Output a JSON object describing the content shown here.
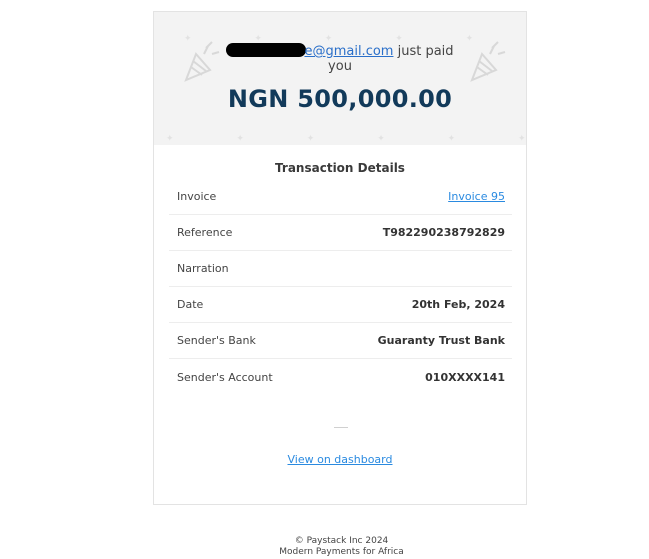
{
  "receipt": {
    "payer_email_visible": "e@gmail.com",
    "paid_text": "just paid",
    "you_text": "you",
    "amount": "NGN 500,000.00"
  },
  "details": {
    "title": "Transaction Details",
    "rows": [
      {
        "label": "Invoice",
        "value": "Invoice 95"
      },
      {
        "label": "Reference",
        "value": "T982290238792829"
      },
      {
        "label": "Narration",
        "value": ""
      },
      {
        "label": "Date",
        "value": "20th Feb, 2024"
      },
      {
        "label": "Sender's Bank",
        "value": "Guaranty Trust Bank"
      },
      {
        "label": "Sender's Account",
        "value": "010XXXX141"
      }
    ]
  },
  "actions": {
    "dashboard_link": "View on dashboard"
  },
  "footer": {
    "copyright": "© Paystack Inc 2024",
    "tagline": "Modern Payments for Africa"
  },
  "colors": {
    "amount": "#123a5a",
    "link": "#2a8ae0",
    "hero_bg": "#f3f3f3"
  }
}
